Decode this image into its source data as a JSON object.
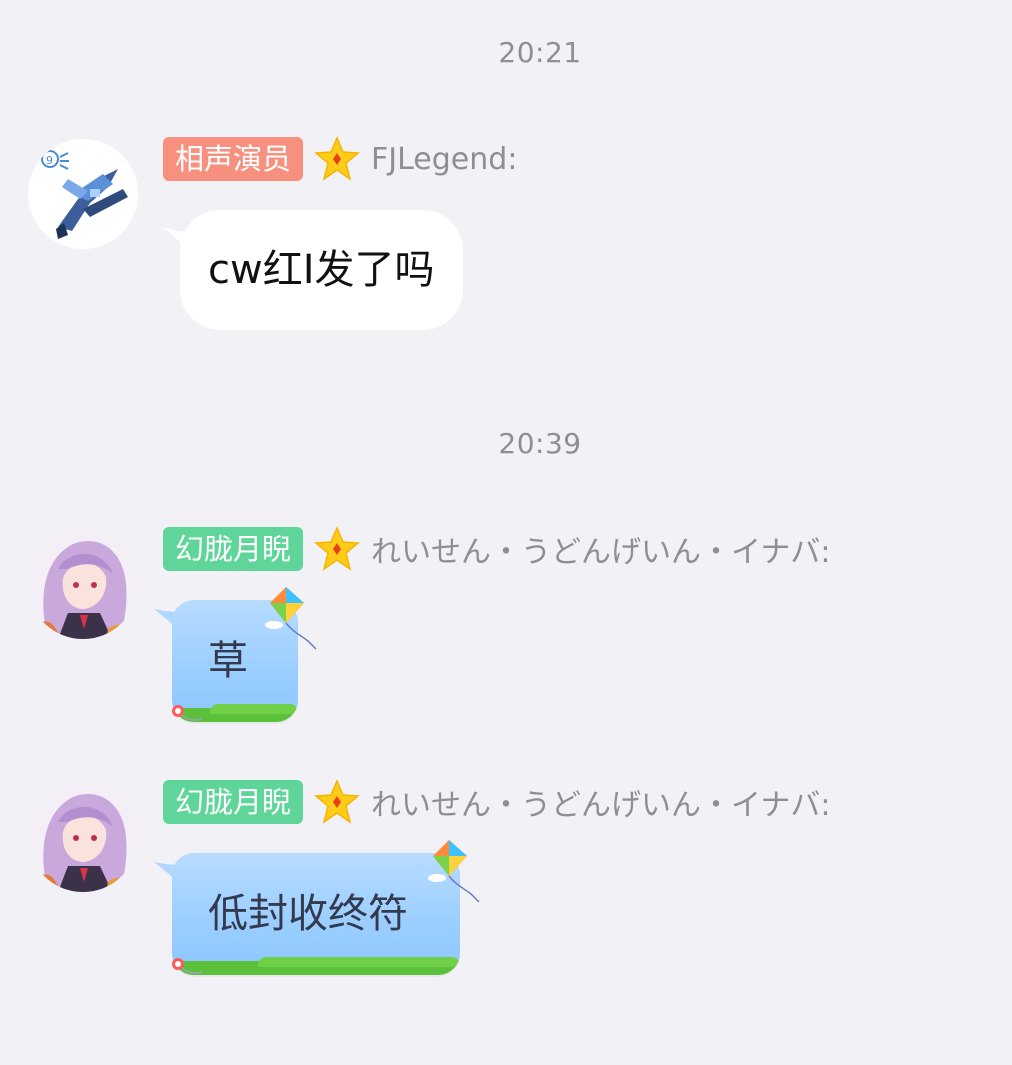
{
  "timestamps": [
    "20:21",
    "20:39"
  ],
  "messages": [
    {
      "avatar": "mecha-avatar",
      "tag": "相声演员",
      "tag_color": "#f7907f",
      "badge_icon": "star-badge-icon",
      "sender": "FJLegend:",
      "text": "cw红I发了吗",
      "bubble_style": "white"
    },
    {
      "avatar": "anime-girl-avatar",
      "tag": "幻胧月睨",
      "tag_color": "#5fd59a",
      "badge_icon": "star-badge-icon",
      "sender": "れいせん・うどんげいん・イナバ:",
      "text": "草",
      "bubble_style": "kite-blue"
    },
    {
      "avatar": "anime-girl-avatar",
      "tag": "幻胧月睨",
      "tag_color": "#5fd59a",
      "badge_icon": "star-badge-icon",
      "sender": "れいせん・うどんげいん・イナバ:",
      "text": "低封收终符",
      "bubble_style": "kite-blue"
    }
  ]
}
